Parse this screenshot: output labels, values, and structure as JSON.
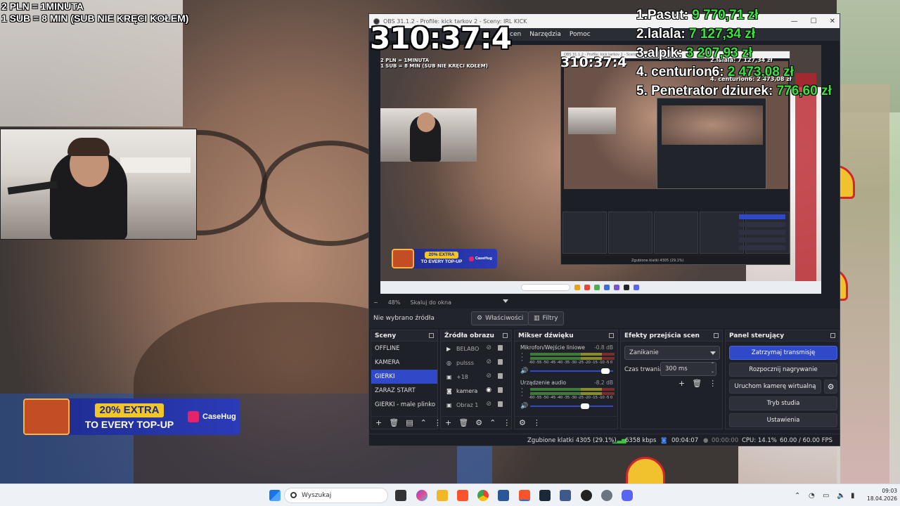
{
  "overlay": {
    "rules": [
      "2 PLN =  1MINUTA",
      "1 SUB = 8 MIN (SUB NIE KRĘCI KOŁEM)"
    ],
    "timer": "310:37:4",
    "leaderboard": [
      {
        "name": "1.Pasut:",
        "amount": "9 770,71 zł"
      },
      {
        "name": "2.lalala:",
        "amount": "7 127,34 zł"
      },
      {
        "name": "3.alpik:",
        "amount": "3 207,93 zł"
      },
      {
        "name": "4. centurion6:",
        "amount": "2 473,08 zł"
      },
      {
        "name": "5. Penetrator dziurek:",
        "amount": "776,60 zł"
      }
    ],
    "promo": {
      "line1": "20% EXTRA",
      "line2": "TO EVERY TOP-UP",
      "brand": "CaseHug"
    }
  },
  "obs": {
    "title": "OBS 31.1.2 - Profile: kick tarkov 2 - Sceny: IRL KICK",
    "menu": [
      "Narzędzia",
      "Pomoc"
    ],
    "menu_partial": "cen",
    "zoom": {
      "value": "48%",
      "mode": "Skaluj do okna",
      "minus": "−"
    },
    "no_source": "Nie wybrano źródła",
    "properties_label": "Właściwości",
    "filters_label": "Filtry",
    "scenes": {
      "title": "Sceny",
      "items": [
        "OFFLINE",
        "KAMERA",
        "GIERKI",
        "ZARAZ START",
        "GIERKI - male plinko"
      ],
      "active": "GIERKI"
    },
    "sources": {
      "title": "Źródła obrazu",
      "items": [
        {
          "label": "BELABO",
          "icon": "play-icon",
          "visible": false
        },
        {
          "label": "pulsss",
          "icon": "globe-icon",
          "visible": false
        },
        {
          "label": "+18",
          "icon": "image-icon",
          "visible": false
        },
        {
          "label": "kamera",
          "icon": "camera-icon",
          "visible": true
        },
        {
          "label": "Obraz 1",
          "icon": "image-icon",
          "visible": false
        }
      ]
    },
    "mixer": {
      "title": "Mikser dźwięku",
      "channels": [
        {
          "name": "Mikrofon/Wejście liniowe",
          "db": "-0.8 dB",
          "scale": "-60 -55 -50 -45 -40 -35 -30 -25 -20 -15 -10 -5 0",
          "volume": 0.95
        },
        {
          "name": "Urządzenie audio",
          "db": "-8.2 dB",
          "scale": "-60 -55 -50 -45 -40 -35 -30 -25 -20 -15 -10 -5 0",
          "volume": 0.68
        }
      ]
    },
    "transitions": {
      "title": "Efekty przejścia scen",
      "selected": "Zanikanie",
      "duration_label": "Czas trwania",
      "duration": "300 ms"
    },
    "controls": {
      "title": "Panel sterujący",
      "stop_stream": "Zatrzymaj transmisję",
      "start_recording": "Rozpocznij nagrywanie",
      "virtual_cam": "Uruchom kamerę wirtualną",
      "studio_mode": "Tryb studia",
      "settings": "Ustawienia"
    },
    "status": {
      "dropped": "Zgubione klatki 4305 (29.1%)",
      "bitrate": "6358 kbps",
      "stream_time": "00:04:07",
      "rec_time": "00:00:00",
      "cpu": "CPU: 14.1%",
      "fps": "60.00 / 60.00 FPS"
    }
  },
  "preview": {
    "rules": [
      "2 PLN = 1MINUTA",
      "1 SUB = 8 MIN (SUB NIE KRĘCI KOŁEM)"
    ],
    "timer": "310:37:4",
    "leaderboard_partial": [
      "2.lalala: 7 127,34 zł",
      "4. centurion6: 2 473,08 zł"
    ],
    "promo": {
      "line1": "20% EXTRA",
      "line2": "TO EVERY TOP-UP",
      "brand": "CaseHug"
    }
  },
  "taskbar": {
    "search_placeholder": "Wyszukaj",
    "time": "09:03",
    "date": "18.04.2026"
  }
}
